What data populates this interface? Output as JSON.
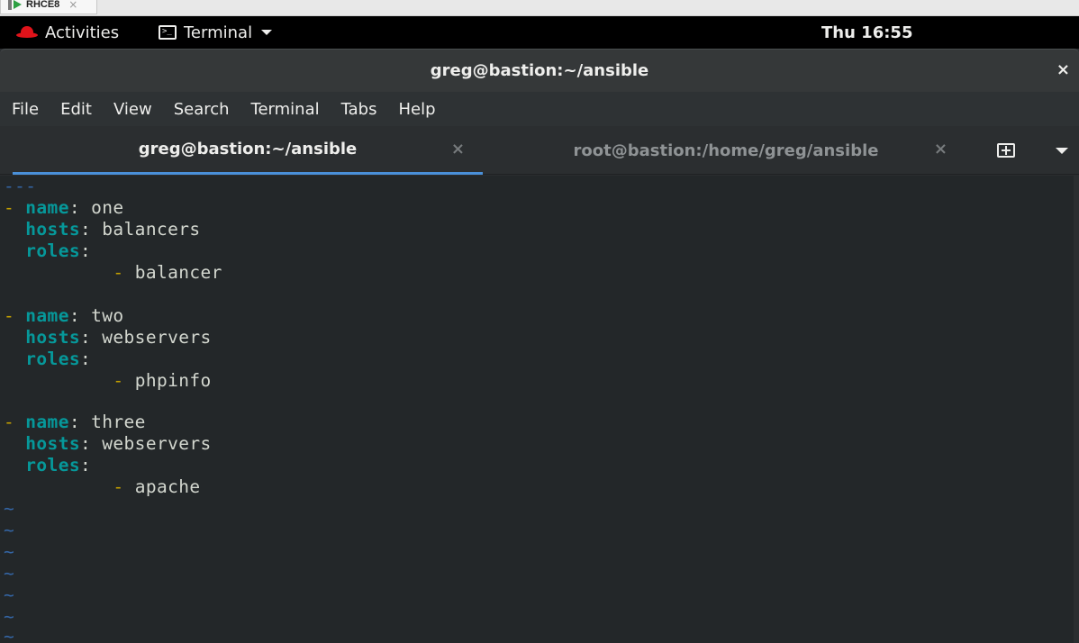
{
  "vm": {
    "name": "RHCE8",
    "close_glyph": "×"
  },
  "topbar": {
    "activities_label": "Activities",
    "app_label": "Terminal",
    "clock": "Thu 16:55"
  },
  "window": {
    "title": "greg@bastion:~/ansible",
    "close_glyph": "×"
  },
  "menubar": {
    "items": [
      "File",
      "Edit",
      "View",
      "Search",
      "Terminal",
      "Tabs",
      "Help"
    ]
  },
  "tabs": [
    {
      "label": "greg@bastion:~/ansible",
      "active": true,
      "close_glyph": "×"
    },
    {
      "label": "root@bastion:/home/greg/ansible",
      "active": false,
      "close_glyph": "×"
    }
  ],
  "terminal": {
    "doc_start": "---",
    "plays": [
      {
        "name_key": "name",
        "name": "one",
        "hosts_key": "hosts",
        "hosts": "balancers",
        "roles_key": "roles",
        "role": "balancer"
      },
      {
        "name_key": "name",
        "name": "two",
        "hosts_key": "hosts",
        "hosts": "webservers",
        "roles_key": "roles",
        "role": "phpinfo"
      },
      {
        "name_key": "name",
        "name": "three",
        "hosts_key": "hosts",
        "hosts": "webservers",
        "roles_key": "roles",
        "role": "apache"
      }
    ],
    "dash": "-",
    "colon": ":",
    "tilde": "~"
  },
  "colors": {
    "key": "#06989a",
    "dash": "#c4a000",
    "tilde": "#3465a4",
    "tab_accent": "#4a90d9",
    "redhat": "#e0131a"
  }
}
